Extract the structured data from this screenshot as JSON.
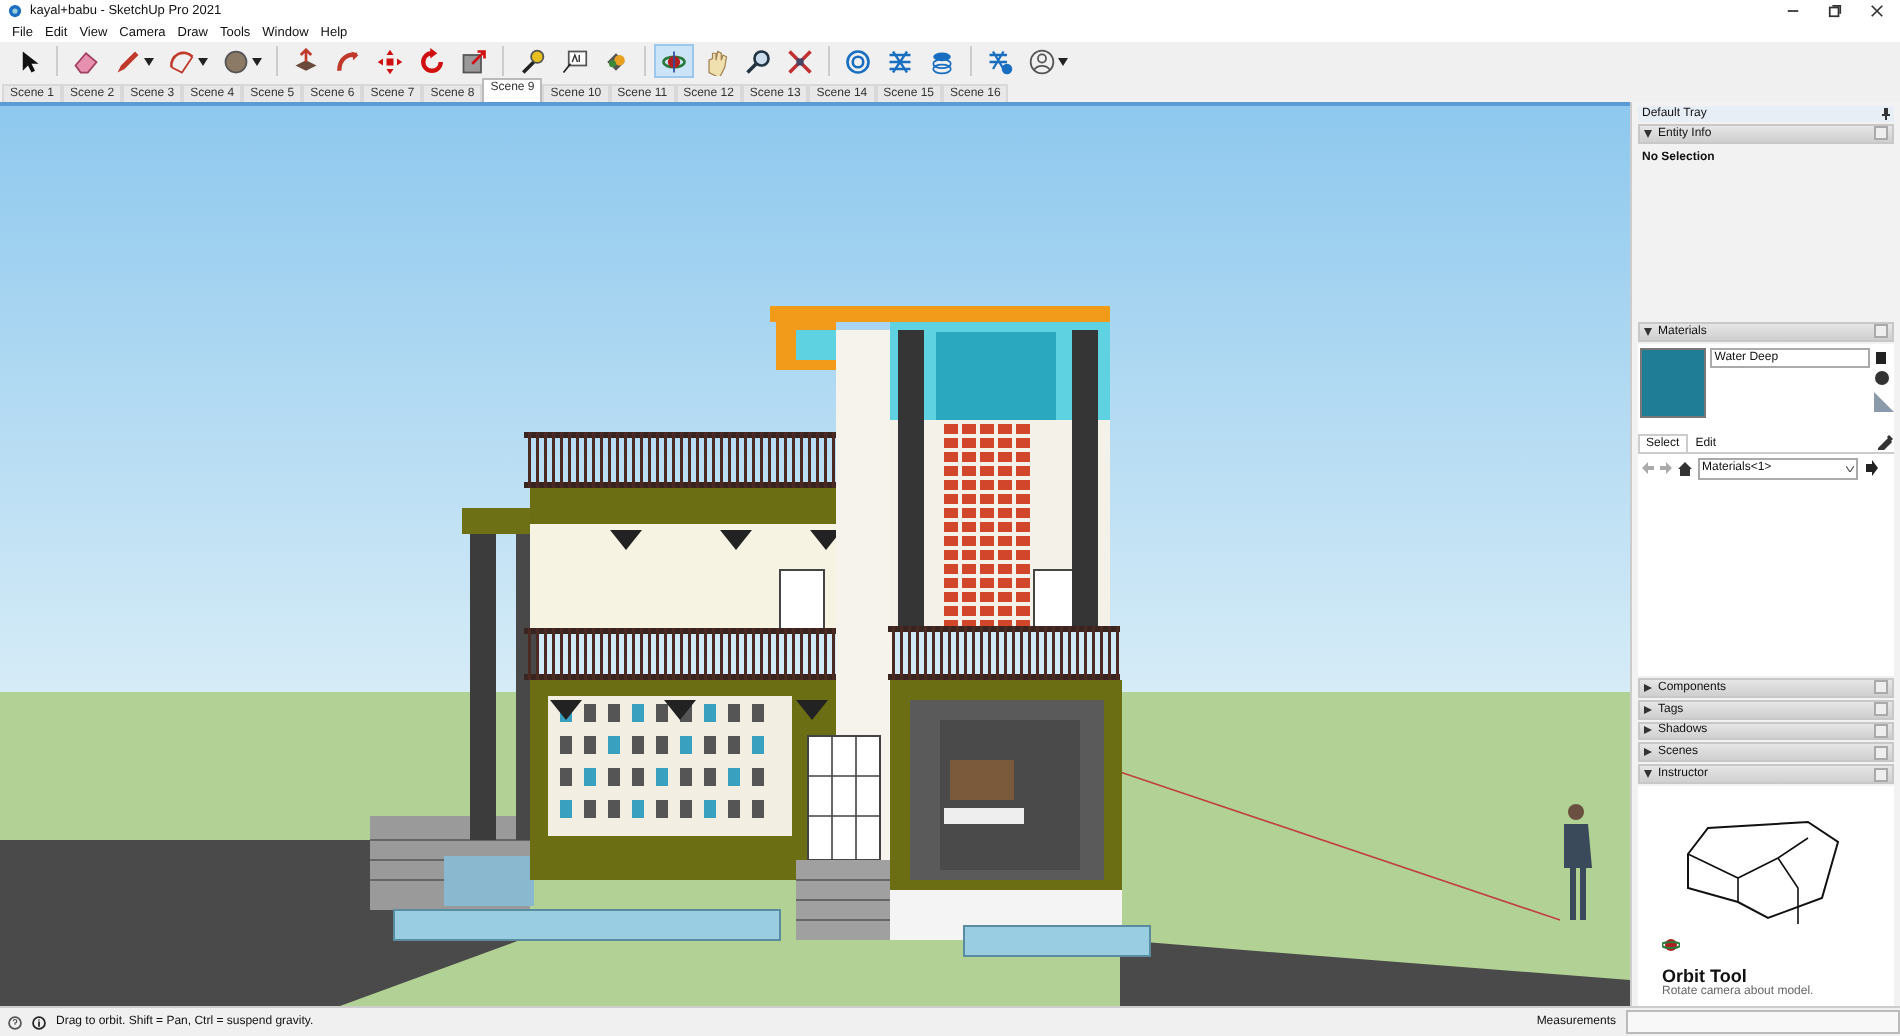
{
  "window": {
    "title": "kayal+babu - SketchUp Pro 2021"
  },
  "menu": [
    "File",
    "Edit",
    "View",
    "Camera",
    "Draw",
    "Tools",
    "Window",
    "Help"
  ],
  "toolbar": {
    "tools": [
      {
        "selected": false
      },
      {
        "selected": false
      },
      {
        "selected": false
      },
      {
        "selected": false
      },
      {
        "selected": false
      },
      {
        "selected": false
      },
      {
        "selected": false
      },
      {
        "selected": false
      },
      {
        "selected": false
      },
      {
        "selected": false
      },
      {
        "selected": false
      },
      {
        "selected": false
      },
      {
        "selected": false
      },
      {
        "selected": true
      },
      {
        "selected": false
      },
      {
        "selected": false
      },
      {
        "selected": false
      },
      {
        "selected": false
      },
      {
        "selected": false
      },
      {
        "selected": false
      },
      {
        "selected": false
      },
      {
        "selected": false
      }
    ]
  },
  "scenes": [
    {
      "label": "Scene 1",
      "selected": false
    },
    {
      "label": "Scene 2",
      "selected": false
    },
    {
      "label": "Scene 3",
      "selected": false
    },
    {
      "label": "Scene 4",
      "selected": false
    },
    {
      "label": "Scene 5",
      "selected": false
    },
    {
      "label": "Scene 6",
      "selected": false
    },
    {
      "label": "Scene 7",
      "selected": false
    },
    {
      "label": "Scene 8",
      "selected": false
    },
    {
      "label": "Scene 9",
      "selected": true
    },
    {
      "label": "Scene 10",
      "selected": false
    },
    {
      "label": "Scene 11",
      "selected": false
    },
    {
      "label": "Scene 12",
      "selected": false
    },
    {
      "label": "Scene 13",
      "selected": false
    },
    {
      "label": "Scene 14",
      "selected": false
    },
    {
      "label": "Scene 15",
      "selected": false
    },
    {
      "label": "Scene 16",
      "selected": false
    }
  ],
  "tray": {
    "title": "Default Tray",
    "panels": [
      {
        "kind": "entity_info",
        "title": "Entity Info",
        "expanded": true,
        "text": "No Selection"
      },
      {
        "kind": "materials",
        "title": "Materials",
        "expanded": true,
        "material_name": "Water Deep",
        "tabs": [
          {
            "label": "Select",
            "selected": true
          },
          {
            "label": "Edit",
            "selected": false
          }
        ],
        "library": "Materials<1>"
      },
      {
        "kind": "plain",
        "title": "Components",
        "expanded": false
      },
      {
        "kind": "plain",
        "title": "Tags",
        "expanded": false
      },
      {
        "kind": "plain",
        "title": "Shadows",
        "expanded": false
      },
      {
        "kind": "plain",
        "title": "Scenes",
        "expanded": false
      },
      {
        "kind": "instructor",
        "title": "Instructor",
        "expanded": true,
        "tool_name": "Orbit Tool",
        "description": "Rotate camera about model."
      }
    ]
  },
  "status_bar": {
    "hint": "Drag to orbit. Shift = Pan, Ctrl = suspend gravity.",
    "measurements_label": "Measurements"
  }
}
